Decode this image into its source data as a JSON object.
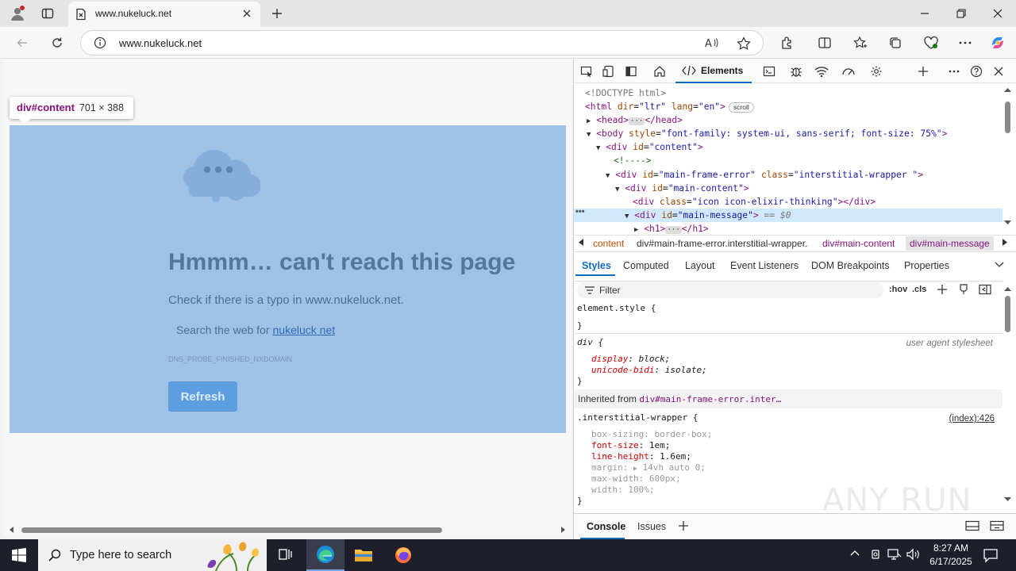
{
  "browser": {
    "tab_title": "www.nukeluck.net",
    "url": "www.nukeluck.net"
  },
  "inspector_tooltip": {
    "selector": "div#content",
    "dimensions": "701 × 388"
  },
  "error_page": {
    "heading": "Hmmm… can't reach this page",
    "subtitle": "Check if there is a typo in www.nukeluck.net.",
    "search_prefix": "Search the web for",
    "search_link": "nukeluck net",
    "error_code": "DNS_PROBE_FINISHED_NXDOMAIN",
    "refresh_label": "Refresh"
  },
  "devtools": {
    "active_tab": "Elements",
    "dom_tree": {
      "doctype": "<!DOCTYPE html>",
      "html_open": "<html",
      "html_attrs": [
        {
          "name": "dir",
          "value": "\"ltr\""
        },
        {
          "name": "lang",
          "value": "\"en\""
        }
      ],
      "html_badge": "scroll",
      "head": "<head>",
      "head_close": "</head>",
      "body_open": "<body",
      "body_attr_name": "style",
      "body_attr_value": "\"font-family: system-ui, sans-serif; font-size: 75%\"",
      "content_div": "<div",
      "content_attr_name": "id",
      "content_attr_value": "\"content\"",
      "comment": "<!---->",
      "mfe_div": "<div",
      "mfe_id_name": "id",
      "mfe_id_value": "\"main-frame-error\"",
      "mfe_class_name": "class",
      "mfe_class_value": "\"interstitial-wrapper \"",
      "mc_div": "<div",
      "mc_id_name": "id",
      "mc_id_value": "\"main-content\"",
      "icon_div": "<div",
      "icon_class_name": "class",
      "icon_class_value": "\"icon icon-elixir-thinking\"",
      "icon_close": "</div>",
      "mm_div": "<div",
      "mm_id_name": "id",
      "mm_id_value": "\"main-message\"",
      "mm_marker": "== $0",
      "h1_open": "<h1>",
      "h1_close": "</h1>"
    },
    "breadcrumbs": [
      "content",
      "div#main-frame-error.interstitial-wrapper.",
      "div#main-content",
      "div#main-message"
    ],
    "subtabs": [
      "Styles",
      "Computed",
      "Layout",
      "Event Listeners",
      "DOM Breakpoints",
      "Properties"
    ],
    "filter_placeholder": "Filter",
    "filter_buttons": {
      "hov": ":hov",
      "cls": ".cls"
    },
    "styles": {
      "element_style_open": "element.style {",
      "close_brace": "}",
      "div_selector": "div {",
      "ua_label": "user agent stylesheet",
      "div_rules": [
        {
          "name": "display",
          "value": "block;"
        },
        {
          "name": "unicode-bidi",
          "value": "isolate;"
        }
      ],
      "inherited_label": "Inherited from",
      "inherited_link": "div#main-frame-error.inter…",
      "wrapper_selector": ".interstitial-wrapper {",
      "wrapper_source": "(index):426",
      "wrapper_rules": [
        {
          "name": "box-sizing",
          "value": "border-box;",
          "faded": true
        },
        {
          "name": "font-size",
          "value": "1em;",
          "faded": false
        },
        {
          "name": "line-height",
          "value": "1.6em;",
          "faded": false
        },
        {
          "name": "margin",
          "value": "14vh auto 0;",
          "faded": true
        },
        {
          "name": "max-width",
          "value": "600px;",
          "faded": true
        },
        {
          "name": "width",
          "value": "100%;",
          "faded": true
        }
      ]
    },
    "drawer_tabs": [
      "Console",
      "Issues"
    ]
  },
  "taskbar": {
    "search_placeholder": "Type here to search",
    "time": "8:27 AM",
    "date": "6/17/2025"
  },
  "watermark": "ANY RUN",
  "colors": {
    "overlay": "#9fc1e6",
    "accent": "#0f6cbd",
    "taskbar": "#1d1f2a"
  }
}
